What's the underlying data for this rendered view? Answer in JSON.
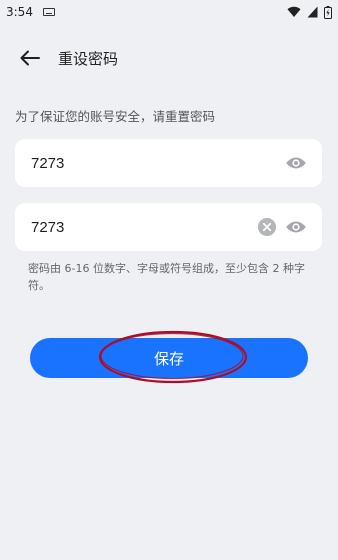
{
  "status_bar": {
    "time": "3:54",
    "icons": [
      "keyboard-icon",
      "wifi-icon",
      "signal-icon",
      "battery-charging-icon"
    ]
  },
  "header": {
    "back_icon": "arrow-left-icon",
    "title": "重设密码"
  },
  "hint": "为了保证您的账号安全，请重置密码",
  "password_field": {
    "value": "7273",
    "visibility_icon": "eye-icon"
  },
  "confirm_field": {
    "value": "7273",
    "clear_icon": "clear-circle-icon",
    "visibility_icon": "eye-icon"
  },
  "rule_text": "密码由 6-16 位数字、字母或符号组成，至少包含 2 种字符。",
  "save_button": {
    "label": "保存"
  },
  "colors": {
    "background": "#eef0f4",
    "primary": "#1a73ff",
    "annotation": "#a8102a",
    "icon_gray": "#a6a8ad"
  }
}
